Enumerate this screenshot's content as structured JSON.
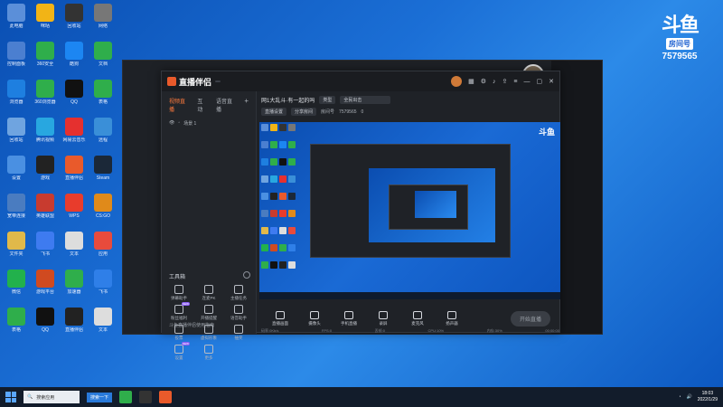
{
  "desktop": {
    "icons": [
      {
        "label": "此电脑",
        "color": "#5b8fd9"
      },
      {
        "label": "咪咕",
        "color": "#f2b416"
      },
      {
        "label": "回收站",
        "color": "#333333"
      },
      {
        "label": "网络",
        "color": "#777777"
      },
      {
        "label": "控制面板",
        "color": "#4b7fd0"
      },
      {
        "label": "360安全",
        "color": "#2fae4b"
      },
      {
        "label": "酷狗",
        "color": "#1c86f2"
      },
      {
        "label": "文档",
        "color": "#2fae4b"
      },
      {
        "label": "浏览器",
        "color": "#1e7fe0"
      },
      {
        "label": "360浏览器",
        "color": "#2fae4b"
      },
      {
        "label": "QQ",
        "color": "#111111"
      },
      {
        "label": "表格",
        "color": "#2fae4b"
      },
      {
        "label": "回收站",
        "color": "#6fa4e0"
      },
      {
        "label": "腾讯视频",
        "color": "#28a7e0"
      },
      {
        "label": "网易云音乐",
        "color": "#e5302f"
      },
      {
        "label": "远程",
        "color": "#3a8fd8"
      },
      {
        "label": "设置",
        "color": "#4a90e2"
      },
      {
        "label": "游戏",
        "color": "#222222"
      },
      {
        "label": "直播伴侣",
        "color": "#e95a2b"
      },
      {
        "label": "Steam",
        "color": "#1b2838"
      },
      {
        "label": "宽带连接",
        "color": "#4a7cc0"
      },
      {
        "label": "英雄联盟",
        "color": "#c83b2f"
      },
      {
        "label": "WPS",
        "color": "#e83c2c"
      },
      {
        "label": "CS:GO",
        "color": "#e08a1a"
      },
      {
        "label": "文件夹",
        "color": "#e0b94a"
      },
      {
        "label": "飞书",
        "color": "#3e7bf0"
      },
      {
        "label": "文本",
        "color": "#dddddd"
      },
      {
        "label": "应用",
        "color": "#e84b3c"
      },
      {
        "label": "微信",
        "color": "#22b14c"
      },
      {
        "label": "游戏平台",
        "color": "#d04a20"
      },
      {
        "label": "加速器",
        "color": "#2fae4b"
      },
      {
        "label": "飞书",
        "color": "#2f7fe8"
      },
      {
        "label": "表格",
        "color": "#2fae4b"
      },
      {
        "label": "QQ",
        "color": "#111111"
      },
      {
        "label": "直播伴侣",
        "color": "#222222"
      },
      {
        "label": "文本",
        "color": "#dddddd"
      }
    ]
  },
  "douyu_widget": {
    "logo": "斗鱼",
    "tag": "房间号",
    "room_number": "7579565"
  },
  "bg_window": {
    "user": "昵称"
  },
  "app": {
    "logo": "直播伴侣",
    "badge": "",
    "tabs": [
      "视频直播",
      "互动",
      "语音直播"
    ],
    "add_tab": "+",
    "scene": "场景 1",
    "tools_title": "工具箱",
    "tools": [
      {
        "label": "弹幕助手"
      },
      {
        "label": "连麦PK"
      },
      {
        "label": "主播任务"
      },
      {
        "label": "粉丝福利",
        "new": "NEW"
      },
      {
        "label": "开播提醒"
      },
      {
        "label": "语音助手"
      },
      {
        "label": "投票"
      },
      {
        "label": "虚拟形象"
      },
      {
        "label": "抽奖"
      },
      {
        "label": "设置",
        "new": "NEW"
      },
      {
        "label": "更多"
      }
    ],
    "hint": "斗鱼直播伴侣使用指南",
    "room_title": "网1大乱斗·有一起的吗",
    "category_chip": "类型",
    "category_value": "全民出击",
    "sub_chip1": "直播设置",
    "sub_chip2": "分享房间",
    "room_id_label": "房间号",
    "room_id": "7579565",
    "online_count": "0",
    "controls": [
      {
        "label": "直播画面"
      },
      {
        "label": "摄像头"
      },
      {
        "label": "手机直播"
      },
      {
        "label": "录屏"
      },
      {
        "label": "麦克风"
      },
      {
        "label": "扬声器"
      }
    ],
    "go_live_button": "开始直播",
    "status": {
      "bitrate": "码率:0Kb/s",
      "fps": "FPS:0",
      "lost": "丢帧:0",
      "cpu": "CPU:10%",
      "mem": "内存:30%",
      "duration": "00:00:00"
    }
  },
  "taskbar": {
    "search_placeholder": "搜索应用",
    "search_button": "搜索一下",
    "time": "18:03",
    "date": "2022/1/29"
  }
}
